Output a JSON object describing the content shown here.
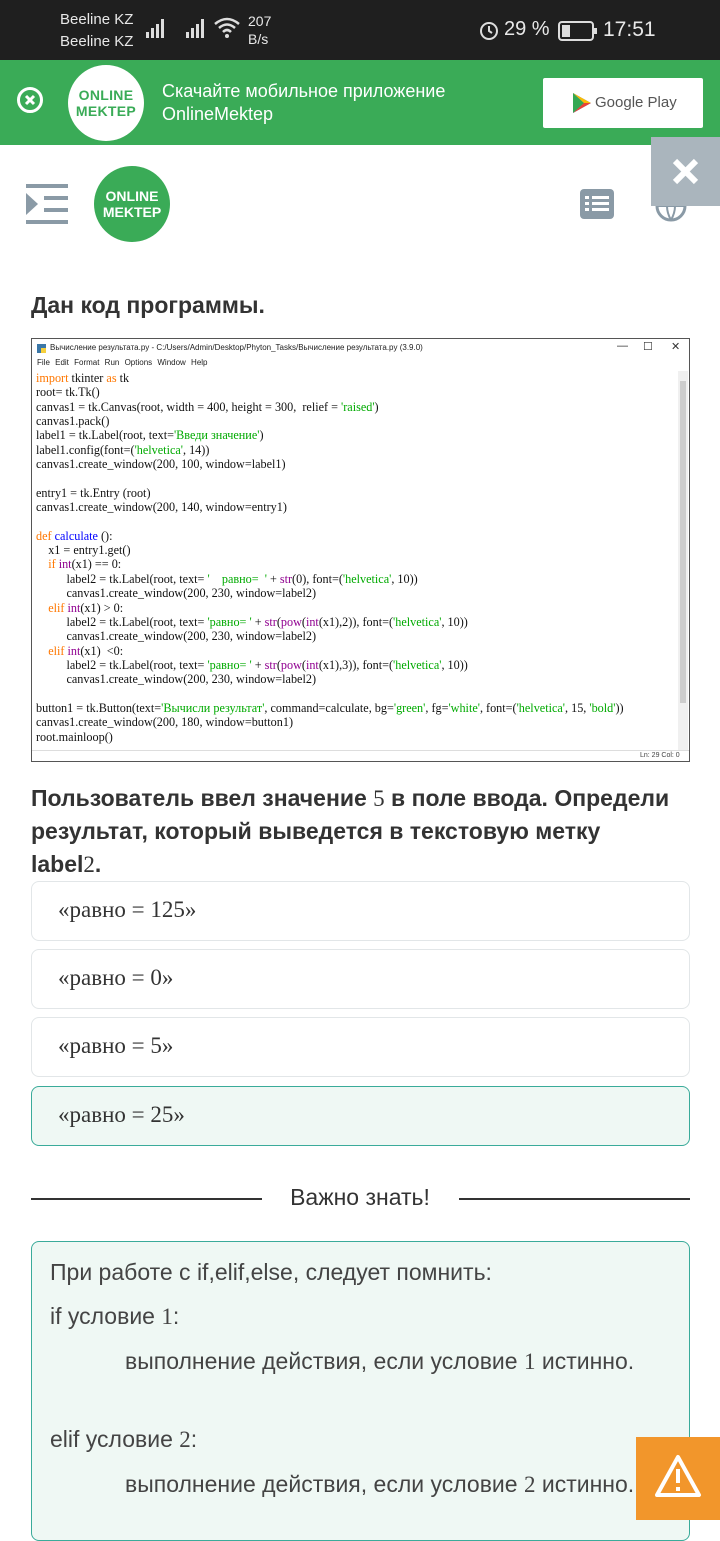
{
  "status_bar": {
    "carrier1": "Beeline KZ",
    "carrier2": "Beeline KZ",
    "speed_value": "207",
    "speed_unit": "B/s",
    "battery": "29 %",
    "time": "17:51"
  },
  "banner": {
    "logo_line1": "ONLINE",
    "logo_line2": "MEKTEP",
    "text_line1": "Скачайте мобильное приложение",
    "text_line2": "OnlineMektep",
    "store_label": "Google Play"
  },
  "header": {
    "logo_line1": "ONLINE",
    "logo_line2": "MEKTEP"
  },
  "question": {
    "title": "Дан код программы.",
    "prompt_part1": "Пользователь ввел значение ",
    "prompt_num": "5",
    "prompt_part2": " в поле ввода. Определи результат, который выведется в текстовую метку label",
    "prompt_num2": "2",
    "prompt_end": "."
  },
  "code_window": {
    "title": "Вычисление результата.py - C:/Users/Admin/Desktop/Phyton_Tasks/Вычисление результата.py (3.9.0)",
    "menu": "File  Edit  Format  Run  Options  Window  Help",
    "status": "Ln: 29   Col: 0"
  },
  "options": [
    {
      "label": "«равно = 125»",
      "selected": false
    },
    {
      "label": "«равно = 0»",
      "selected": false
    },
    {
      "label": "«равно = 5»",
      "selected": false
    },
    {
      "label": "«равно = 25»",
      "selected": true
    }
  ],
  "important": {
    "title": "Важно знать!",
    "line1": "При работе с if,elif,else, следует помнить:",
    "line2_a": "if условие ",
    "line2_n": "1",
    "line2_b": ":",
    "line3_a": "выполнение действия, если условие ",
    "line3_n": "1",
    "line3_b": " истинно.",
    "line4_a": "elif условие ",
    "line4_n": "2",
    "line4_b": ":",
    "line5_a": "выполнение действия, если условие ",
    "line5_n": "2",
    "line5_b": " истинно."
  },
  "colors": {
    "brand_green": "#3aab57",
    "selected_border": "#3aab9a",
    "warning_orange": "#f2962b"
  }
}
